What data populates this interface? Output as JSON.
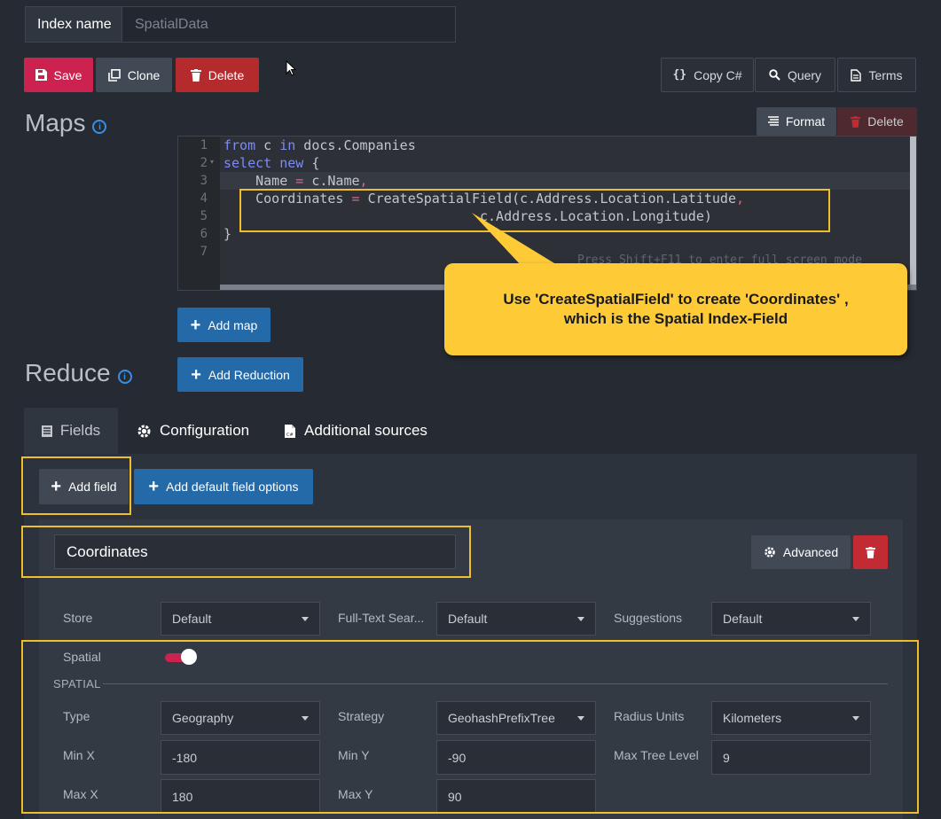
{
  "index": {
    "label": "Index name",
    "value": "SpatialData"
  },
  "toolbar": {
    "save": "Save",
    "clone": "Clone",
    "delete": "Delete",
    "copy": "Copy C#",
    "query": "Query",
    "terms": "Terms"
  },
  "maps": {
    "title": "Maps",
    "format": "Format",
    "delete": "Delete"
  },
  "editor": {
    "line_numbers": [
      "1",
      "2",
      "3",
      "4",
      "5",
      "6",
      "7"
    ],
    "l1_kw1": "from",
    "l1_a": " c ",
    "l1_kw2": "in",
    "l1_b": " docs.Companies",
    "l2_kw": "select new",
    "l2_a": " {",
    "l3_a": "    Name",
    "l3_op": " = ",
    "l3_b": "c.Name",
    "l3_comma": ",",
    "l4_a": "    Coordinates",
    "l4_op": " = ",
    "l4_b": "CreateSpatialField(c.Address.Location.Latitude",
    "l4_comma": ",",
    "l5": "                                c.Address.Location.Longitude)",
    "l6": "}",
    "hint": "Press Shift+F11 to enter full screen mode"
  },
  "callout": {
    "line1": "Use 'CreateSpatialField' to create 'Coordinates' ,",
    "line2": "which is the Spatial Index-Field"
  },
  "add_map": "Add map",
  "reduce": {
    "title": "Reduce",
    "add": "Add Reduction"
  },
  "tabs": {
    "fields": "Fields",
    "configuration": "Configuration",
    "sources": "Additional sources"
  },
  "fields": {
    "add_field": "Add field",
    "add_default": "Add default field options",
    "name": "Coordinates",
    "advanced": "Advanced",
    "store_label": "Store",
    "store_value": "Default",
    "fts_label": "Full-Text Sear...",
    "fts_value": "Default",
    "sugg_label": "Suggestions",
    "sugg_value": "Default",
    "spatial_label": "Spatial",
    "spatial_on": true,
    "spatial_heading": "SPATIAL",
    "type_label": "Type",
    "type_value": "Geography",
    "strategy_label": "Strategy",
    "strategy_value": "GeohashPrefixTree",
    "radius_label": "Radius Units",
    "radius_value": "Kilometers",
    "minx_label": "Min X",
    "minx_value": "-180",
    "miny_label": "Min Y",
    "miny_value": "-90",
    "maxtree_label": "Max Tree Level",
    "maxtree_value": "9",
    "maxx_label": "Max X",
    "maxx_value": "180",
    "maxy_label": "Max Y",
    "maxy_value": "90"
  },
  "colors": {
    "accent": "#cc2250",
    "primary": "#246aa8",
    "danger": "#b42a2d",
    "highlight": "#f0bd2b",
    "callout": "#fecb37"
  }
}
